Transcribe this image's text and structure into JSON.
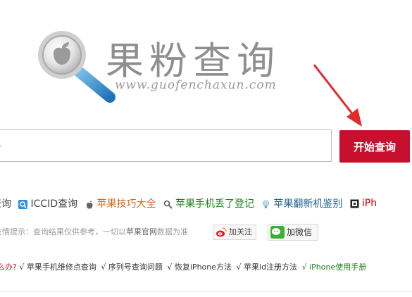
{
  "logo": {
    "title": "果粉查询",
    "subtitle": "www.guofenchaxun.com"
  },
  "search": {
    "input_visible_text": "号",
    "button_label": "开始查询"
  },
  "links": [
    {
      "label": "查询",
      "icon": "partial-icon",
      "color": "#444444"
    },
    {
      "label": "ICCID查询",
      "icon": "iccid-blue-icon",
      "color": "#444444"
    },
    {
      "label": "苹果技巧大全",
      "icon": "apple-icon",
      "color": "#d2691e"
    },
    {
      "label": "苹果手机丢了登记",
      "icon": "search-icon",
      "color": "#1a7f1a"
    },
    {
      "label": "苹果翻新机鉴别",
      "icon": "lightbulb-icon",
      "color": "#1f5f8b"
    },
    {
      "label": "iPh",
      "icon": "box-icon",
      "color": "#cc0000"
    }
  ],
  "tip": {
    "prefix": "友情提示：查询结果仅供参考，一切以",
    "emphasis": "苹果官网",
    "suffix": "数据为准",
    "follow_label": "加关注",
    "wechat_label": "加微信"
  },
  "bottom_links": {
    "lead": "么办?",
    "items": [
      "√ 苹果手机维修点查询",
      "√ 序列号查询问题",
      "√ 恢复iPhone方法",
      "√ 苹果id注册方法"
    ],
    "last": "√ iPhone使用手册"
  }
}
